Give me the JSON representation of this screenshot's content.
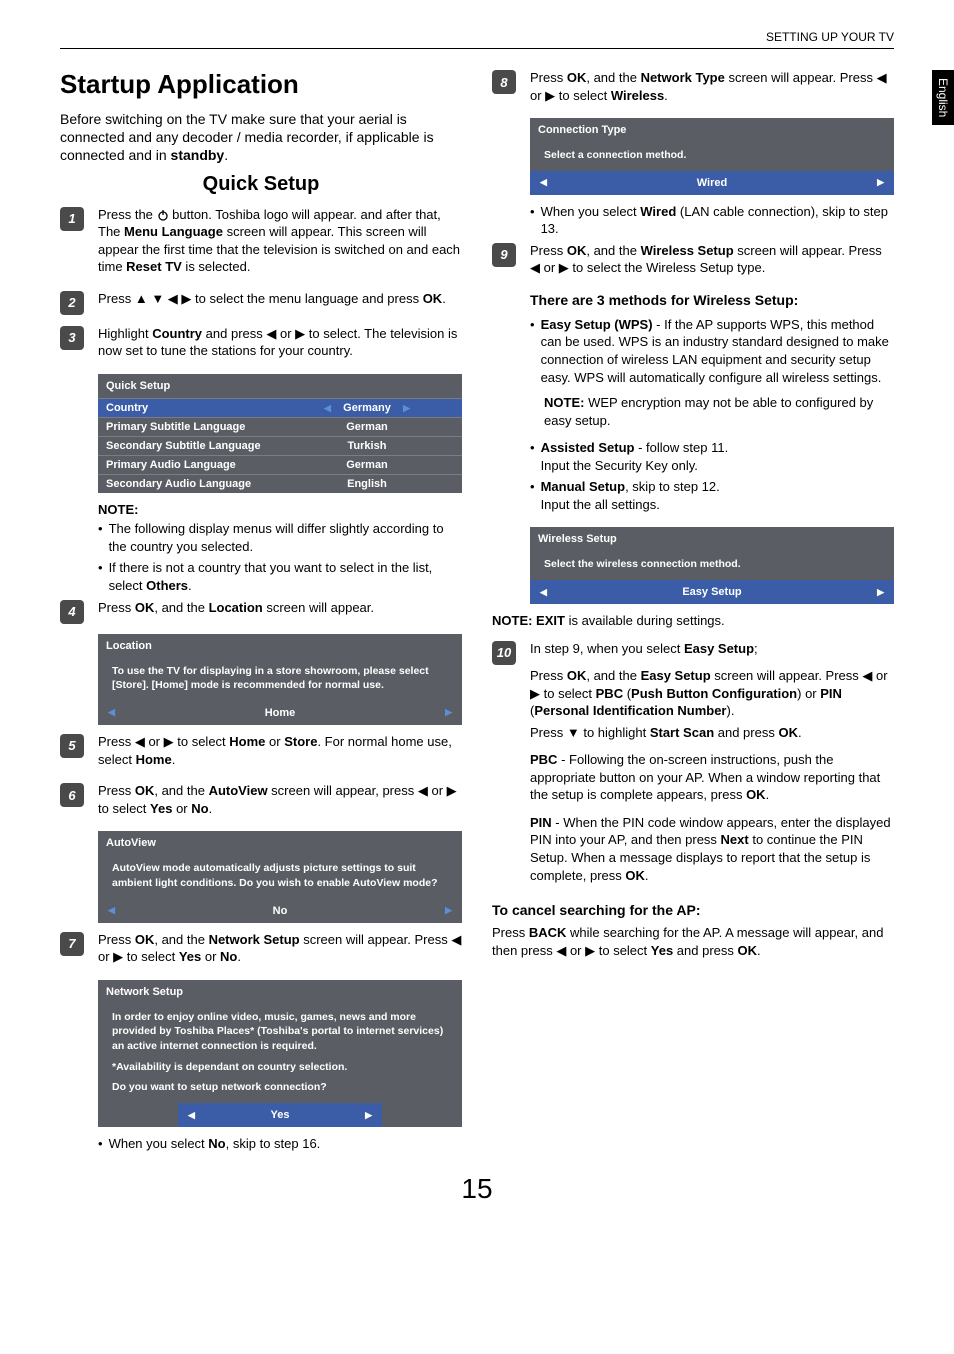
{
  "header": {
    "section": "SETTING UP YOUR TV",
    "language_tab": "English"
  },
  "h1": "Startup Application",
  "intro": "Before switching on the TV make sure that your aerial is connected and any decoder / media recorder, if applicable is connected and in ",
  "intro_bold": "standby",
  "h2": "Quick Setup",
  "steps": {
    "s1_a": "Press the ",
    "s1_b": " button. Toshiba logo will appear. and after that, The ",
    "s1_bold": "Menu Language",
    "s1_c": " screen will appear. This screen will appear the first time that the television is switched on and each time ",
    "s1_bold2": "Reset TV",
    "s1_d": " is selected.",
    "s2_a": "Press ",
    "s2_b": " to select the menu language and press ",
    "s2_bold": "OK",
    "s3_a": "Highlight ",
    "s3_bold": "Country",
    "s3_b": " and press ",
    "s3_c": " or ",
    "s3_d": " to select. The television is now set to tune the stations for your country.",
    "note_hdr": "NOTE:",
    "n3_1": "The following display menus will differ slightly according to the country you selected.",
    "n3_2a": "If there is not a country that you want to select in the list, select ",
    "n3_2b": "Others",
    "s4_a": "Press ",
    "s4_bold": "OK",
    "s4_b": ", and the ",
    "s4_bold2": "Location",
    "s4_c": " screen will appear.",
    "s5_a": "Press ",
    "s5_b": " or ",
    "s5_c": " to select ",
    "s5_bold": "Home",
    "s5_d": " or ",
    "s5_bold2": "Store",
    "s5_e": ". For normal home use, select ",
    "s5_bold3": "Home",
    "s6_a": "Press ",
    "s6_bold": "OK",
    "s6_b": ", and the ",
    "s6_bold2": "AutoView",
    "s6_c": " screen will appear, press ",
    "s6_d": " or ",
    "s6_e": " to select ",
    "s6_bold3": "Yes",
    "s6_f": " or ",
    "s6_bold4": "No",
    "s7_a": "Press ",
    "s7_bold": "OK",
    "s7_b": ", and the ",
    "s7_bold2": "Network Setup",
    "s7_c": " screen will appear. Press ",
    "s7_d": " or ",
    "s7_e": " to select ",
    "s7_bold3": "Yes",
    "s7_f": " or ",
    "s7_bold4": "No",
    "s7_note_a": "When you select ",
    "s7_note_bold": "No",
    "s7_note_b": ", skip to step 16.",
    "s8_a": "Press ",
    "s8_bold": "OK",
    "s8_b": ", and the ",
    "s8_bold2": "Network Type",
    "s8_c": " screen will appear. Press ",
    "s8_d": " or ",
    "s8_e": " to select ",
    "s8_bold3": "Wireless",
    "s8_note_a": "When you select ",
    "s8_note_bold": "Wired",
    "s8_note_b": " (LAN cable connection), skip to step 13.",
    "s9_a": "Press ",
    "s9_bold": "OK",
    "s9_b": ", and the ",
    "s9_bold2": "Wireless Setup",
    "s9_c": " screen will appear. Press ",
    "s9_d": " or ",
    "s9_e": " to select the Wireless Setup type.",
    "s9_h3": "There are 3 methods for Wireless Setup:",
    "s9_m1_bold": "Easy Setup (WPS)",
    "s9_m1": " - If the AP supports WPS, this method can be used. WPS is an industry standard designed to make connection of wireless LAN equipment and security setup easy. WPS will automatically configure all wireless settings.",
    "s9_note_bold": "NOTE:",
    "s9_note": "  WEP encryption may not be able to configured by easy setup.",
    "s9_m2_bold": "Assisted Setup",
    "s9_m2": " -  follow step 11.",
    "s9_m2b": "Input the Security Key only.",
    "s9_m3_bold": "Manual Setup",
    "s9_m3": ", skip to step 12.",
    "s9_m3b": "Input the all settings.",
    "s9_exit_bold": "NOTE: EXIT",
    "s9_exit": " is available during settings.",
    "s10_a": "In step 9, when you select ",
    "s10_bold": "Easy Setup",
    "s10_b": ";",
    "s10_p2a": "Press ",
    "s10_p2bold": "OK",
    "s10_p2b": ", and the ",
    "s10_p2bold2": "Easy Setup",
    "s10_p2c": " screen will appear. Press ",
    "s10_p2d": " or ",
    "s10_p2e": " to select ",
    "s10_p2bold3": "PBC",
    "s10_p2f": " (",
    "s10_p2bold4": "Push Button Configuration",
    "s10_p2g": ") or ",
    "s10_p2bold5": "PIN",
    "s10_p2h": " (",
    "s10_p2bold6": "Personal Identification Number",
    "s10_p2i": ").",
    "s10_p3a": "Press ",
    "s10_p3b": " to highlight ",
    "s10_p3bold": "Start Scan",
    "s10_p3c": " and press ",
    "s10_p3bold2": "OK",
    "s10_pbc_bold": "PBC",
    "s10_pbc": " - Following the on-screen instructions, push the appropriate button on your AP. When a window reporting that the setup is complete appears, press ",
    "s10_pbc_bold2": "OK",
    "s10_pin_bold": "PIN",
    "s10_pin": " - When the PIN code window appears, enter the displayed PIN into your AP, and then press ",
    "s10_pin_bold2": "Next",
    "s10_pin_b": " to continue the PIN Setup. When a message displays to report that the setup is complete, press ",
    "s10_pin_bold3": "OK",
    "cancel_h3": "To cancel searching for the AP:",
    "cancel_a": "Press ",
    "cancel_bold": "BACK",
    "cancel_b": " while searching for the AP. A message will appear, and then press ",
    "cancel_c": " or ",
    "cancel_d": " to select ",
    "cancel_bold2": "Yes",
    "cancel_e": " and press ",
    "cancel_bold3": "OK"
  },
  "ui": {
    "quick_setup": {
      "title": "Quick Setup",
      "rows": [
        {
          "label": "Country",
          "value": "Germany",
          "highlight": true,
          "arrows": true
        },
        {
          "label": "Primary Subtitle Language",
          "value": "German"
        },
        {
          "label": "Secondary Subtitle Language",
          "value": "Turkish"
        },
        {
          "label": "Primary Audio Language",
          "value": "German"
        },
        {
          "label": "Secondary Audio Language",
          "value": "English"
        }
      ]
    },
    "location": {
      "title": "Location",
      "body": "To use the TV for displaying in a store showroom, please select [Store].  [Home] mode is recommended for normal use.",
      "value": "Home"
    },
    "autoview": {
      "title": "AutoView",
      "body": "AutoView mode automatically adjusts picture settings to suit ambient light conditions. Do you wish to enable AutoView mode?",
      "value": "No"
    },
    "network": {
      "title": "Network Setup",
      "body1": "In order to enjoy online video, music, games, news and more provided by Toshiba Places* (Toshiba's portal to internet services) an active internet connection is required.",
      "body2": "*Availability is dependant on country selection.",
      "body3": "Do you want to setup network connection?",
      "value": "Yes"
    },
    "conn_type": {
      "title": "Connection Type",
      "body": "Select a connection method.",
      "value": "Wired"
    },
    "wireless": {
      "title": "Wireless Setup",
      "body": "Select the wireless connection method.",
      "value": "Easy Setup"
    }
  },
  "page_number": "15"
}
